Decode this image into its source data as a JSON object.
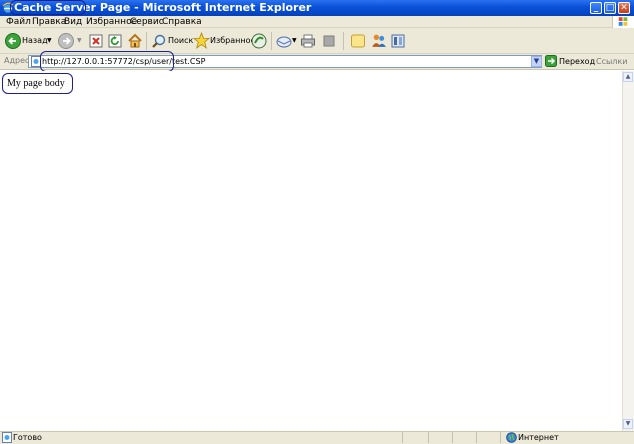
{
  "window": {
    "title": "Cache Server Page - Microsoft Internet Explorer",
    "minimize_glyph": "_",
    "maximize_glyph": "□",
    "close_glyph": "✕"
  },
  "menu": [
    "Файл",
    "Правка",
    "Вид",
    "Избранное",
    "Сервис",
    "Справка"
  ],
  "toolbar": {
    "back_label": "Назад",
    "search_label": "Поиск",
    "favorites_label": "Избранное"
  },
  "address": {
    "label": "Адрес",
    "url": "http://127.0.0.1:57772/csp/user/test.CSP",
    "go_label": "Переход",
    "links_label": "Ссылки"
  },
  "page": {
    "body_text": "My page body"
  },
  "status": {
    "text": "Готово",
    "zone": "Интернет"
  },
  "colors": {
    "title_bar": "#0a50d8",
    "chrome": "#ece9d8",
    "annotation_outline": "#1c1f8f"
  },
  "icons": [
    "ie-icon",
    "back-arrow-icon",
    "forward-arrow-icon",
    "stop-icon",
    "refresh-icon",
    "home-icon",
    "search-icon",
    "favorites-star-icon",
    "media-icon",
    "mail-icon",
    "print-icon",
    "edit-icon",
    "discuss-icon",
    "messenger-icon",
    "research-icon",
    "page-icon",
    "go-arrow-icon",
    "windows-logo-icon",
    "internet-zone-icon"
  ]
}
